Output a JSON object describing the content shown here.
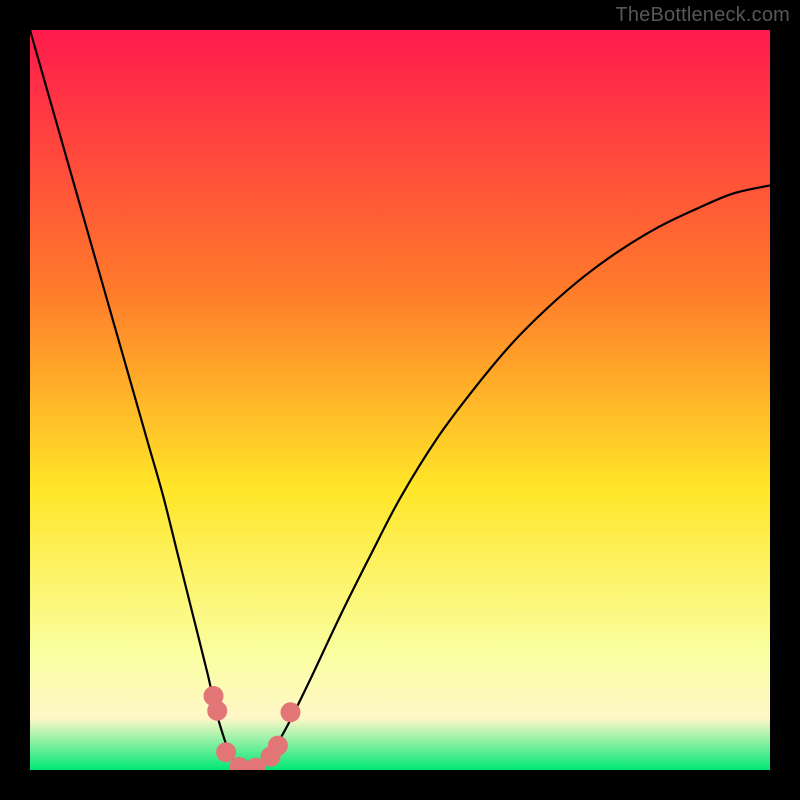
{
  "watermark": "TheBottleneck.com",
  "colors": {
    "frame": "#000000",
    "gradient_top": "#ff1a4d",
    "gradient_mid1": "#ff7a2a",
    "gradient_mid2": "#ffe628",
    "gradient_band": "#faffa0",
    "gradient_bottom": "#00e876",
    "curve": "#000000",
    "markers": "#e27575"
  },
  "chart_data": {
    "type": "line",
    "title": "",
    "xlabel": "",
    "ylabel": "",
    "xlim": [
      0,
      1
    ],
    "ylim": [
      0,
      1
    ],
    "series": [
      {
        "name": "bottleneck-curve",
        "x": [
          0.0,
          0.02,
          0.04,
          0.06,
          0.08,
          0.1,
          0.12,
          0.14,
          0.16,
          0.18,
          0.2,
          0.22,
          0.24,
          0.25,
          0.26,
          0.27,
          0.28,
          0.29,
          0.3,
          0.31,
          0.32,
          0.33,
          0.35,
          0.38,
          0.42,
          0.46,
          0.5,
          0.55,
          0.6,
          0.65,
          0.7,
          0.75,
          0.8,
          0.85,
          0.9,
          0.95,
          1.0
        ],
        "values": [
          1.0,
          0.93,
          0.86,
          0.79,
          0.72,
          0.65,
          0.58,
          0.51,
          0.44,
          0.37,
          0.29,
          0.21,
          0.13,
          0.085,
          0.05,
          0.022,
          0.008,
          0.0,
          0.0,
          0.003,
          0.012,
          0.028,
          0.064,
          0.125,
          0.21,
          0.29,
          0.367,
          0.448,
          0.515,
          0.575,
          0.625,
          0.668,
          0.704,
          0.734,
          0.758,
          0.779,
          0.79
        ]
      }
    ],
    "markers": {
      "name": "highlight-dots",
      "x": [
        0.248,
        0.253,
        0.265,
        0.283,
        0.305,
        0.325,
        0.335,
        0.352
      ],
      "y": [
        0.1,
        0.08,
        0.024,
        0.004,
        0.003,
        0.018,
        0.033,
        0.078
      ]
    }
  }
}
